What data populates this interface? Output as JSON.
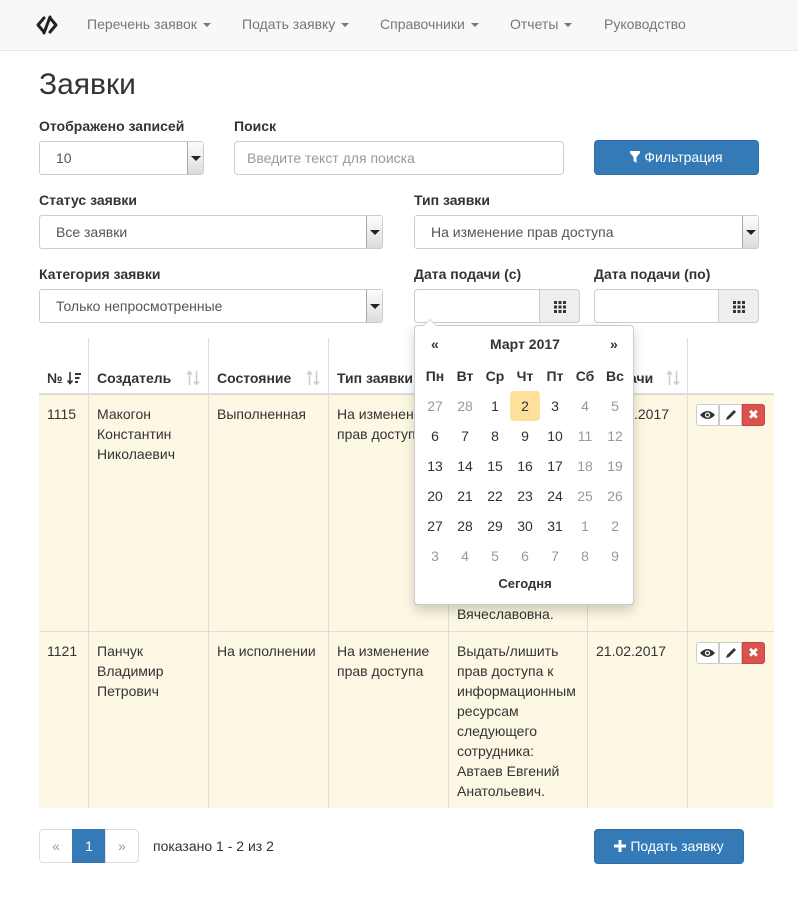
{
  "navbar": {
    "brand_icon": "code-slash-icon",
    "items": [
      {
        "label": "Перечень заявок",
        "dropdown": true
      },
      {
        "label": "Подать заявку",
        "dropdown": true
      },
      {
        "label": "Справочники",
        "dropdown": true
      },
      {
        "label": "Отчеты",
        "dropdown": true
      },
      {
        "label": "Руководство",
        "dropdown": false
      }
    ]
  },
  "page_title": "Заявки",
  "filters": {
    "page_size": {
      "label": "Отображено записей",
      "value": "10"
    },
    "search": {
      "label": "Поиск",
      "placeholder": "Введите текст для поиска"
    },
    "filter_button": "Фильтрация",
    "status": {
      "label": "Статус заявки",
      "value": "Все заявки"
    },
    "type": {
      "label": "Тип заявки",
      "value": "На изменение прав доступа"
    },
    "category": {
      "label": "Категория заявки",
      "value": "Только непросмотренные"
    },
    "date_from": {
      "label": "Дата подачи (с)",
      "value": ""
    },
    "date_to": {
      "label": "Дата подачи (по)",
      "value": ""
    }
  },
  "table": {
    "columns": [
      "№",
      "Создатель",
      "Состояние",
      "Тип заявки",
      "",
      "...ачи",
      ""
    ],
    "rows": [
      {
        "id": "1115",
        "creator": [
          "Макогон",
          "Константин",
          "Николаевич"
        ],
        "state": "Выполненная",
        "type": [
          "На изменен...",
          "прав доступ..."
        ],
        "description_tail": "Вячеславовна.",
        "date_tail": ".2017"
      },
      {
        "id": "1121",
        "creator": [
          "Панчук",
          "Владимир",
          "Петрович"
        ],
        "state": "На исполнении",
        "type": [
          "На изменение",
          "прав доступа"
        ],
        "description": [
          "Выдать/лишить",
          "прав доступа к",
          "информационным",
          "ресурсам",
          "следующего",
          "сотрудника:",
          "Автаев Евгений",
          "Анатольевич."
        ],
        "date": "21.02.2017"
      }
    ]
  },
  "datepicker": {
    "prev": "«",
    "next": "»",
    "month": "Март 2017",
    "weekdays": [
      "Пн",
      "Вт",
      "Ср",
      "Чт",
      "Пт",
      "Сб",
      "Вс"
    ],
    "weeks": [
      [
        "27",
        "28",
        "1",
        "2",
        "3",
        "4",
        "5"
      ],
      [
        "6",
        "7",
        "8",
        "9",
        "10",
        "11",
        "12"
      ],
      [
        "13",
        "14",
        "15",
        "16",
        "17",
        "18",
        "19"
      ],
      [
        "20",
        "21",
        "22",
        "23",
        "24",
        "25",
        "26"
      ],
      [
        "27",
        "28",
        "29",
        "30",
        "31",
        "1",
        "2"
      ],
      [
        "3",
        "4",
        "5",
        "6",
        "7",
        "8",
        "9"
      ]
    ],
    "today_label": "Сегодня",
    "highlighted_day": "2"
  },
  "pagination": {
    "prev": "«",
    "current": "1",
    "next": "»",
    "summary": "показано 1 - 2 из 2"
  },
  "add_button": "Подать заявку",
  "colors": {
    "primary": "#337ab7",
    "row_highlight": "#fcf8e3",
    "today": "#fde19a",
    "danger": "#d9534f"
  }
}
